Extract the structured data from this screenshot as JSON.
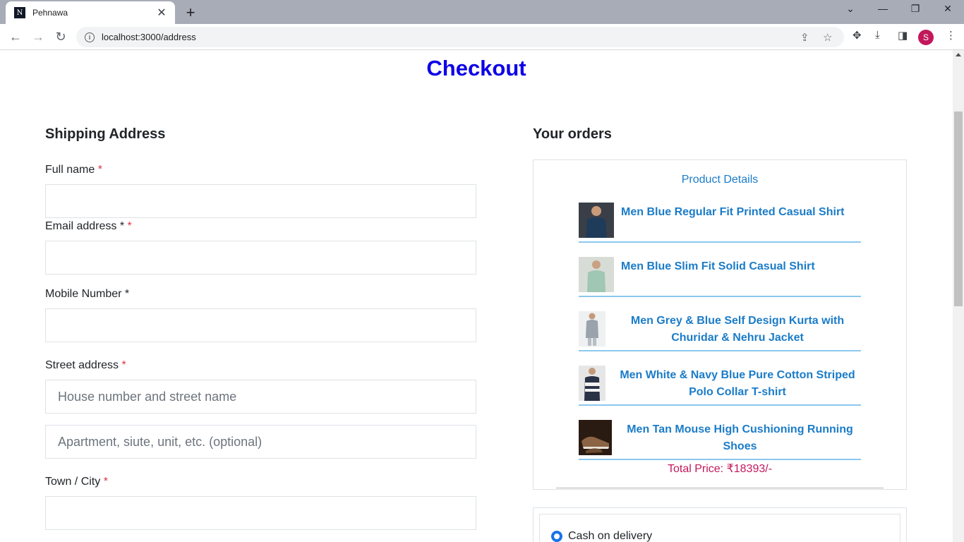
{
  "browser": {
    "tab_title": "Pehnawa",
    "tab_favicon_text": "N",
    "url": "localhost:3000/address",
    "profile_initial": "S"
  },
  "page": {
    "title": "Checkout"
  },
  "shipping": {
    "heading": "Shipping Address",
    "full_name_label": "Full name",
    "email_label": "Email address *",
    "mobile_label": "Mobile Number *",
    "street_label": "Street address",
    "street_placeholder": "House number and street name",
    "apartment_placeholder": "Apartment, siute, unit, etc. (optional)",
    "town_label": "Town / City ",
    "required_mark": "*",
    "full_name_value": "",
    "email_value": "",
    "mobile_value": "",
    "town_value": ""
  },
  "orders": {
    "heading": "Your orders",
    "details_title": "Product Details",
    "items": [
      {
        "name_line1": "Men Blue Regular Fit Printed Casual Shirt",
        "name_line2": "",
        "thumb": "shirt-navy-thumb",
        "color": "#1f3b5a"
      },
      {
        "name_line1": "Men Blue Slim Fit Solid Casual Shirt",
        "name_line2": "",
        "thumb": "shirt-mint-thumb",
        "color": "#9fc7b4"
      },
      {
        "name_line1": "Men Grey & Blue Self Design Kurta with",
        "name_line2": "Churidar & Nehru Jacket",
        "thumb": "kurta-grey-thumb",
        "color": "#9aa3ab"
      },
      {
        "name_line1": "Men White & Navy Blue Pure Cotton Striped",
        "name_line2": "Polo Collar T-shirt",
        "thumb": "polo-striped-thumb",
        "color": "#2a3246"
      },
      {
        "name_line1": "Men Tan Mouse High Cushioning Running",
        "name_line2": "Shoes",
        "thumb": "shoes-tan-thumb",
        "color": "#6b4a32"
      }
    ],
    "total": "Total Price: ₹18393/-"
  },
  "payment": {
    "option_label": "Cash on delivery",
    "selected": true
  }
}
